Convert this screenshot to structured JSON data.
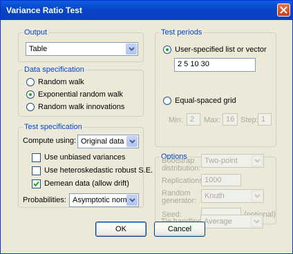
{
  "window": {
    "title": "Variance Ratio Test"
  },
  "output": {
    "legend": "Output",
    "selected": "Table"
  },
  "data_spec": {
    "legend": "Data specification",
    "options": [
      {
        "label": "Random walk",
        "selected": false
      },
      {
        "label": "Exponential random walk",
        "selected": true
      },
      {
        "label": "Random walk innovations",
        "selected": false
      }
    ]
  },
  "test_spec": {
    "legend": "Test specification",
    "compute_label": "Compute using:",
    "compute_value": "Original data",
    "unbiased_label": "Use unbiased variances",
    "unbiased_checked": false,
    "hetero_label": "Use heteroskedastic robust S.E.",
    "hetero_checked": false,
    "demean_label": "Demean data (allow drift)",
    "demean_checked": true,
    "prob_label": "Probabilities:",
    "prob_value": "Asymptotic normal"
  },
  "test_periods": {
    "legend": "Test periods",
    "user_label": "User-specified list or vector",
    "user_selected": true,
    "user_value": "2 5 10 30",
    "grid_label": "Equal-spaced grid",
    "grid_selected": false,
    "min_label": "Min:",
    "min_value": "2",
    "max_label": "Max:",
    "max_value": "16",
    "step_label": "Step:",
    "step_value": "1"
  },
  "options": {
    "legend": "Options",
    "bootstrap_label_1": "Bootstrap",
    "bootstrap_label_2": "distribution:",
    "bootstrap_value": "Two-point",
    "replications_label": "Replications:",
    "replications_value": "1000",
    "random_label_1": "Random",
    "random_label_2": "generator:",
    "random_value": "Knuth",
    "seed_label": "Seed:",
    "seed_value": "",
    "seed_hint": "(optional)",
    "tie_label": "Tie handling:",
    "tie_value": "Average"
  },
  "buttons": {
    "ok": "OK",
    "cancel": "Cancel"
  },
  "colors": {
    "title_bar": "#0a5fe0",
    "legend": "#0046d5",
    "dialog": "#ece9d8",
    "close": "#d8532c"
  }
}
